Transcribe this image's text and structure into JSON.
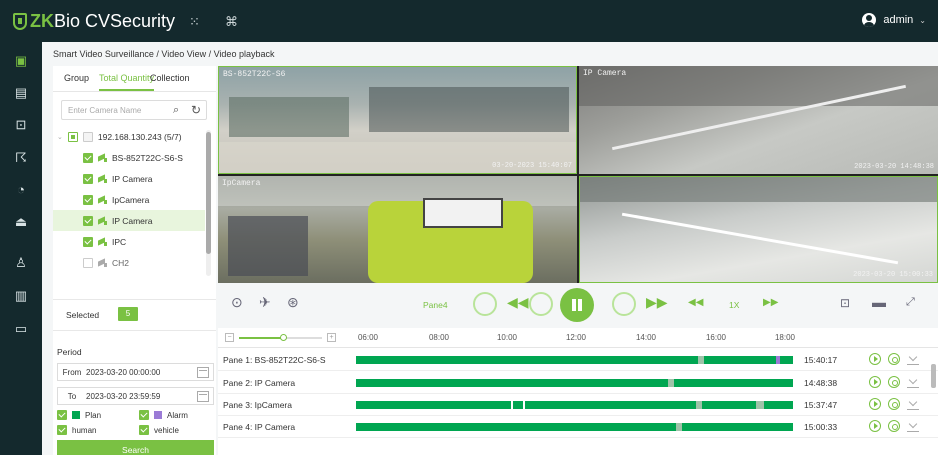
{
  "header": {
    "logo_zk": "ZK",
    "logo_bio": "Bio",
    "logo_rest": "CVSecurity",
    "apps_icon": "grid-icon",
    "cmd_icon": "command-icon",
    "user": "admin",
    "user_caret": "⌄"
  },
  "breadcrumb": "Smart Video Surveillance / Video View / Video playback",
  "nav": [
    "camera-icon",
    "monitor-icon",
    "screen-icon",
    "fingerprint-icon",
    "clock-icon",
    "scan-icon",
    "people-icon",
    "media-icon",
    "chat-icon"
  ],
  "panel": {
    "tabs": [
      "Group",
      "Total Quantity",
      "Collection"
    ],
    "search_placeholder": "Enter Camera Name",
    "tree": [
      {
        "label": "192.168.130.243 (5/7)",
        "level": 0
      },
      {
        "label": "BS-852T22C-S6-S",
        "level": 1
      },
      {
        "label": "IP Camera",
        "level": 1
      },
      {
        "label": "IpCamera",
        "level": 1
      },
      {
        "label": "IP Camera",
        "level": 1
      },
      {
        "label": "IPC",
        "level": 1
      },
      {
        "label": "CH2",
        "level": 1
      }
    ],
    "selected_label": "Selected",
    "selected_count": "5",
    "period_label": "Period",
    "from_label": "From",
    "from_value": "2023-03-20 00:00:00",
    "to_label": "To",
    "to_value": "2023-03-20 23:59:59",
    "filters": [
      {
        "label": "Plan",
        "color": "#00a651"
      },
      {
        "label": "Alarm",
        "color": "#9b7bd6"
      },
      {
        "label": "human"
      },
      {
        "label": "vehicle"
      }
    ],
    "search_button": "Search"
  },
  "video": {
    "panes": [
      {
        "caption": "BS-852T22C-S6",
        "timestamp": "03-20-2023 15:40:07"
      },
      {
        "caption": "IP Camera",
        "timestamp": "2023-03-20 14:48:38"
      },
      {
        "caption": "IpCamera",
        "timestamp": ""
      },
      {
        "caption": "",
        "timestamp": "2023-03-20 15:00:33"
      }
    ]
  },
  "controls": {
    "pane_label": "Pane4",
    "speed": "1X"
  },
  "timeline": {
    "ticks": [
      "06:00",
      "08:00",
      "10:00",
      "12:00",
      "14:00",
      "16:00",
      "18:00"
    ],
    "rows": [
      {
        "name": "Pane 1: BS-852T22C-S6-S",
        "time": "15:40:17"
      },
      {
        "name": "Pane 2: IP Camera",
        "time": "14:48:38"
      },
      {
        "name": "Pane 3: IpCamera",
        "time": "15:37:47"
      },
      {
        "name": "Pane 4: IP Camera",
        "time": "15:00:33"
      }
    ]
  },
  "colors": {
    "accent": "#7ac143",
    "record": "#00a651",
    "alarm": "#9b7bd6"
  }
}
